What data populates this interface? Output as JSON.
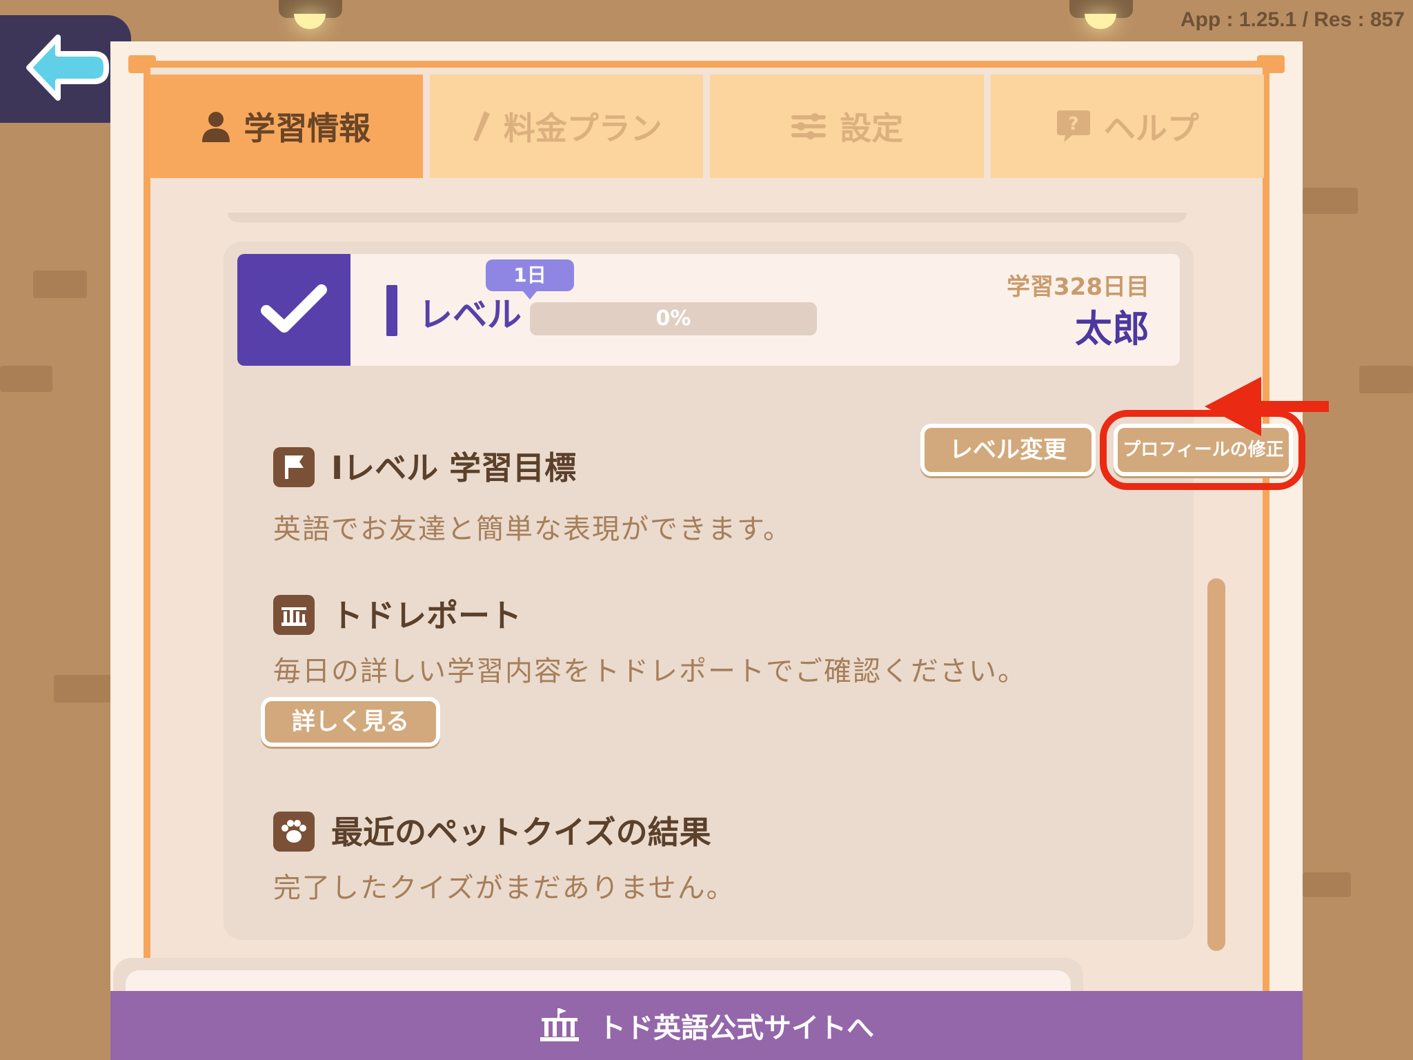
{
  "version_text": "App : 1.25.1 / Res : 857",
  "tabs": [
    {
      "label": "学習情報",
      "icon": "person-icon",
      "active": true
    },
    {
      "label": "料金プラン",
      "icon": "pencil-icon",
      "active": false
    },
    {
      "label": "設定",
      "icon": "sliders-icon",
      "active": false
    },
    {
      "label": "ヘルプ",
      "icon": "help-bubble-icon",
      "active": false
    }
  ],
  "level": {
    "day_badge": "1日",
    "label": "レベル",
    "progress_text": "0%",
    "progress": 0,
    "study_days": "学習328日目",
    "user_name": "太郎"
  },
  "buttons": {
    "level_change": "レベル変更",
    "profile_edit": "プロフィールの修正",
    "details": "詳しく見る"
  },
  "sections": {
    "goal": {
      "title": "Iレベル 学習目標",
      "text": "英語でお友達と簡単な表現ができます。"
    },
    "report": {
      "title": "トドレポート",
      "text": "毎日の詳しい学習内容をトドレポートでご確認ください。"
    },
    "quiz": {
      "title": "最近のペットクイズの結果",
      "text": "完了したクイズがまだありません。"
    }
  },
  "footer": {
    "label": "トド英語公式サイトへ"
  },
  "colors": {
    "accent_orange": "#f7a85d",
    "accent_purple": "#5840aa",
    "footer_purple": "#9466aa",
    "highlight_red": "#ea2a12"
  }
}
